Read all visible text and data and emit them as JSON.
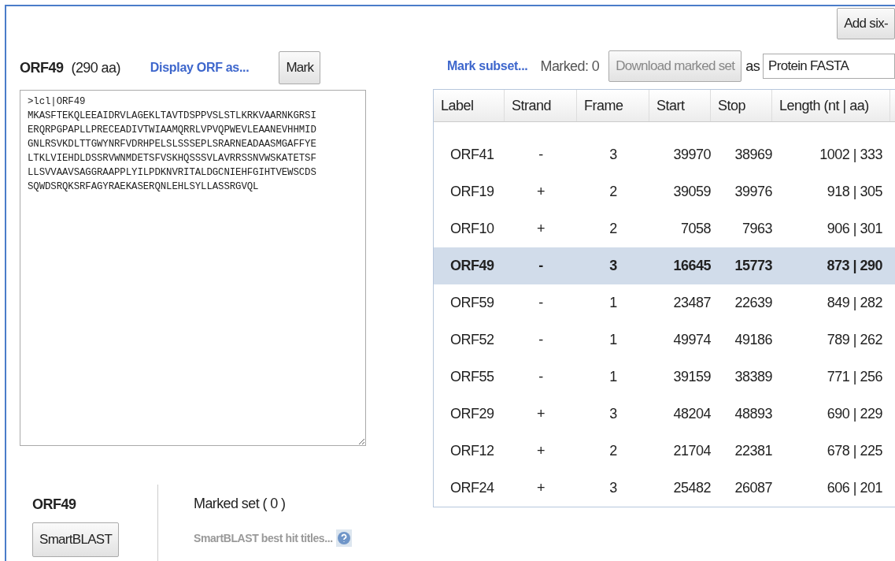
{
  "top_button": "Add six-",
  "orf": {
    "name": "ORF49",
    "length": "(290 aa)",
    "display_link": "Display ORF as...",
    "mark_button": "Mark",
    "sequence": ">lcl|ORF49\nMKASFTEKQLEEAIDRVLAGEKLTAVTDSPPVSLSTLKRKVAARNKGRSI\nERQRPGPAPLLPRECEADIVTWIAAMQRRLVPVQPWEVLEAANEVHHMID\nGNLRSVKDLTTGWYNRFVDRHPELSLSSSEPLSRARNEADAASMGAFFYE\nLTKLVIEHDLDSSRVWNMDETSFVSKHQSSSVLAVRRSSNVWSKATETSF\nLLSVVAAVSAGGRAAPPLYILPDKNVRITALDGCNIEHFGIHTVEWSCDS\nSQWDSRQKSRFAGYRAEKASERQNLEHLSYLLASSRGVQL"
  },
  "toolbar": {
    "subset_link": "Mark subset...",
    "marked": "Marked: 0",
    "download_button": {
      "label": "Download marked set",
      "disabled": true
    },
    "as_label": "as",
    "format": "Protein FASTA"
  },
  "table": {
    "columns": [
      "Label",
      "Strand",
      "Frame",
      "Start",
      "Stop",
      "Length (nt | aa)"
    ],
    "rows": [
      {
        "cells": [
          "ORF41",
          "-",
          "3",
          "39970",
          "38969",
          "1002 | 333"
        ],
        "selected": false
      },
      {
        "cells": [
          "ORF19",
          "+",
          "2",
          "39059",
          "39976",
          "918 | 305"
        ],
        "selected": false
      },
      {
        "cells": [
          "ORF10",
          "+",
          "2",
          "7058",
          "7963",
          "906 | 301"
        ],
        "selected": false
      },
      {
        "cells": [
          "ORF49",
          "-",
          "3",
          "16645",
          "15773",
          "873 | 290"
        ],
        "selected": true
      },
      {
        "cells": [
          "ORF59",
          "-",
          "1",
          "23487",
          "22639",
          "849 | 282"
        ],
        "selected": false
      },
      {
        "cells": [
          "ORF52",
          "-",
          "1",
          "49974",
          "49186",
          "789 | 262"
        ],
        "selected": false
      },
      {
        "cells": [
          "ORF55",
          "-",
          "1",
          "39159",
          "38389",
          "771 | 256"
        ],
        "selected": false
      },
      {
        "cells": [
          "ORF29",
          "+",
          "3",
          "48204",
          "48893",
          "690 | 229"
        ],
        "selected": false
      },
      {
        "cells": [
          "ORF12",
          "+",
          "2",
          "21704",
          "22381",
          "678 | 225"
        ],
        "selected": false
      },
      {
        "cells": [
          "ORF24",
          "+",
          "3",
          "25482",
          "26087",
          "606 | 201"
        ],
        "selected": false
      }
    ]
  },
  "bottom": {
    "orf_name": "ORF49",
    "smartblast_button": "SmartBLAST",
    "marked_set": "Marked set ( 0 )",
    "best_hits": "SmartBLAST best hit titles..."
  }
}
